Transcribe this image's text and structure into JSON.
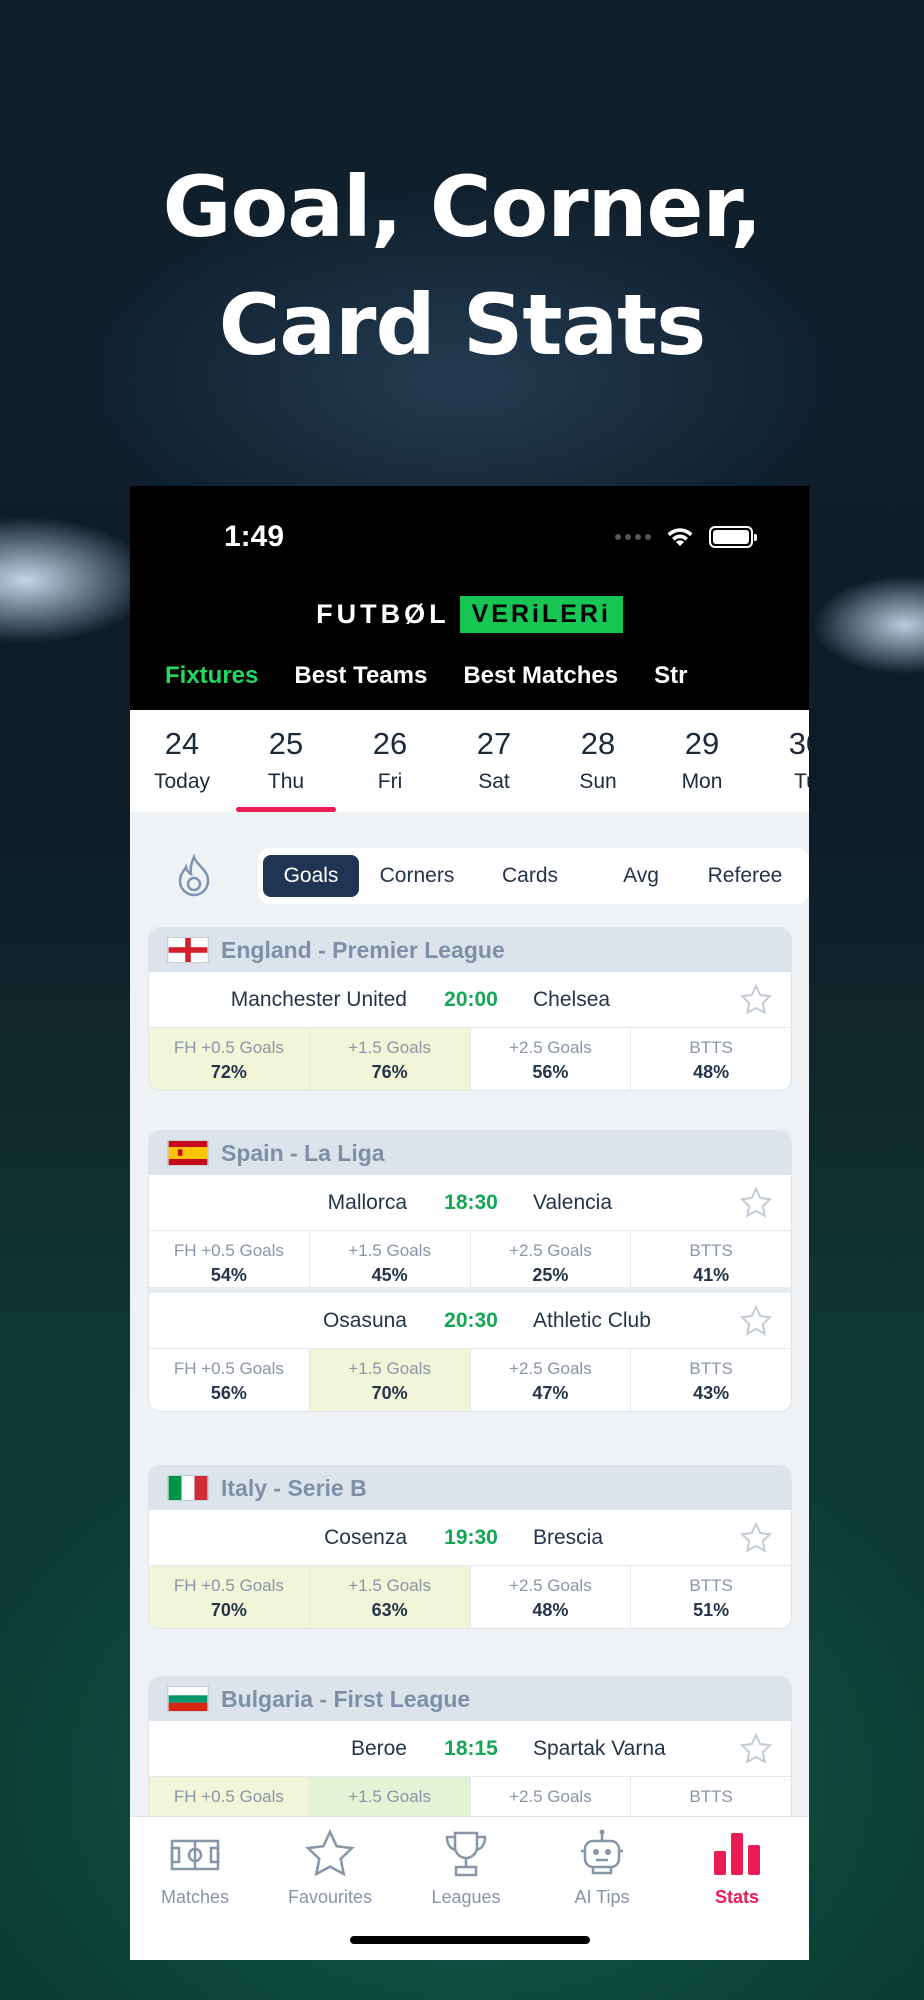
{
  "headline": {
    "line1": "Goal, Corner,",
    "line2": "Card Stats"
  },
  "status": {
    "time": "1:49"
  },
  "logo": {
    "part1": "FUTBØL",
    "part2": "VERiLERi"
  },
  "top_tabs": [
    {
      "label": "Fixtures",
      "active": true
    },
    {
      "label": "Best Teams",
      "active": false
    },
    {
      "label": "Best Matches",
      "active": false
    },
    {
      "label": "Str",
      "active": false
    }
  ],
  "dates": [
    {
      "num": "24",
      "day": "Today"
    },
    {
      "num": "25",
      "day": "Thu",
      "active": true
    },
    {
      "num": "26",
      "day": "Fri"
    },
    {
      "num": "27",
      "day": "Sat"
    },
    {
      "num": "28",
      "day": "Sun"
    },
    {
      "num": "29",
      "day": "Mon"
    },
    {
      "num": "30",
      "day": "Tu"
    }
  ],
  "filters": [
    {
      "label": "Goals",
      "active": true
    },
    {
      "label": "Corners"
    },
    {
      "label": "Cards"
    },
    {
      "label": "Avg"
    },
    {
      "label": "Referee"
    }
  ],
  "leagues": [
    {
      "name": "England - Premier League",
      "flag": "england",
      "matches": [
        {
          "home": "Manchester United",
          "time": "20:00",
          "away": "Chelsea",
          "stats": [
            {
              "label": "FH +0.5 Goals",
              "value": "72%",
              "hl": true
            },
            {
              "label": "+1.5 Goals",
              "value": "76%",
              "hl": true
            },
            {
              "label": "+2.5 Goals",
              "value": "56%",
              "hl": false
            },
            {
              "label": "BTTS",
              "value": "48%",
              "hl": false
            }
          ]
        }
      ]
    },
    {
      "name": "Spain - La Liga",
      "flag": "spain",
      "matches": [
        {
          "home": "Mallorca",
          "time": "18:30",
          "away": "Valencia",
          "stats": [
            {
              "label": "FH +0.5 Goals",
              "value": "54%",
              "hl": false
            },
            {
              "label": "+1.5 Goals",
              "value": "45%",
              "hl": false
            },
            {
              "label": "+2.5 Goals",
              "value": "25%",
              "hl": false
            },
            {
              "label": "BTTS",
              "value": "41%",
              "hl": false
            }
          ]
        },
        {
          "home": "Osasuna",
          "time": "20:30",
          "away": "Athletic Club",
          "stats": [
            {
              "label": "FH +0.5 Goals",
              "value": "56%",
              "hl": false
            },
            {
              "label": "+1.5 Goals",
              "value": "70%",
              "hl": true
            },
            {
              "label": "+2.5 Goals",
              "value": "47%",
              "hl": false
            },
            {
              "label": "BTTS",
              "value": "43%",
              "hl": false
            }
          ]
        }
      ]
    },
    {
      "name": "Italy - Serie B",
      "flag": "italy",
      "matches": [
        {
          "home": "Cosenza",
          "time": "19:30",
          "away": "Brescia",
          "stats": [
            {
              "label": "FH +0.5 Goals",
              "value": "70%",
              "hl": true
            },
            {
              "label": "+1.5 Goals",
              "value": "63%",
              "hl": true
            },
            {
              "label": "+2.5 Goals",
              "value": "48%",
              "hl": false
            },
            {
              "label": "BTTS",
              "value": "51%",
              "hl": false
            }
          ]
        }
      ]
    },
    {
      "name": "Bulgaria - First League",
      "flag": "bulgaria",
      "matches": [
        {
          "home": "Beroe",
          "time": "18:15",
          "away": "Spartak Varna",
          "stats": [
            {
              "label": "FH +0.5 Goals",
              "value": "",
              "hl": true
            },
            {
              "label": "+1.5 Goals",
              "value": "",
              "hl": true
            },
            {
              "label": "+2.5 Goals",
              "value": "",
              "hl": false
            },
            {
              "label": "BTTS",
              "value": "",
              "hl": false
            }
          ]
        }
      ]
    }
  ],
  "tabbar": [
    {
      "label": "Matches",
      "icon": "pitch-icon"
    },
    {
      "label": "Favourites",
      "icon": "star-outline-icon"
    },
    {
      "label": "Leagues",
      "icon": "trophy-icon"
    },
    {
      "label": "AI Tips",
      "icon": "robot-icon"
    },
    {
      "label": "Stats",
      "icon": "bar-chart-icon",
      "active": true
    }
  ],
  "colors": {
    "accent_green": "#22d865",
    "accent_red": "#ea1b55",
    "navy": "#1f3553",
    "highlight": "#f3f5d8"
  }
}
